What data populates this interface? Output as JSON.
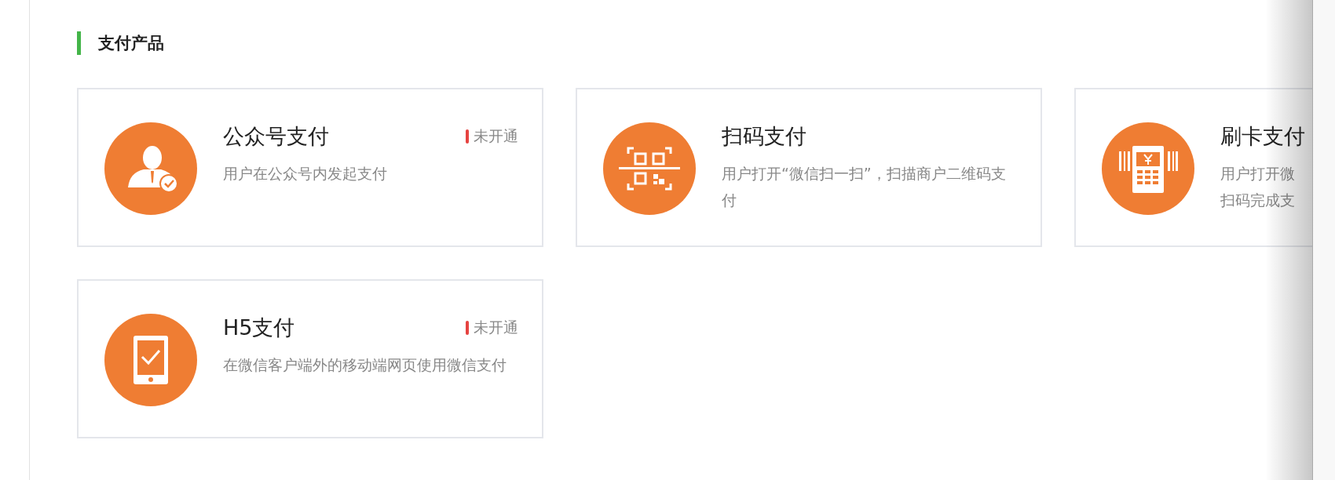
{
  "section": {
    "title": "支付产品"
  },
  "products": [
    {
      "name": "公众号支付",
      "status": "未开通",
      "description": "用户在公众号内发起支付"
    },
    {
      "name": "扫码支付",
      "description": "用户打开“微信扫一扫”，扫描商户二维码支付"
    },
    {
      "name": "刷卡支付",
      "description_lines": [
        "用户打开微",
        "扫码完成支"
      ]
    },
    {
      "name": "H5支付",
      "status": "未开通",
      "description": "在微信客户端外的移动端网页使用微信支付"
    }
  ]
}
